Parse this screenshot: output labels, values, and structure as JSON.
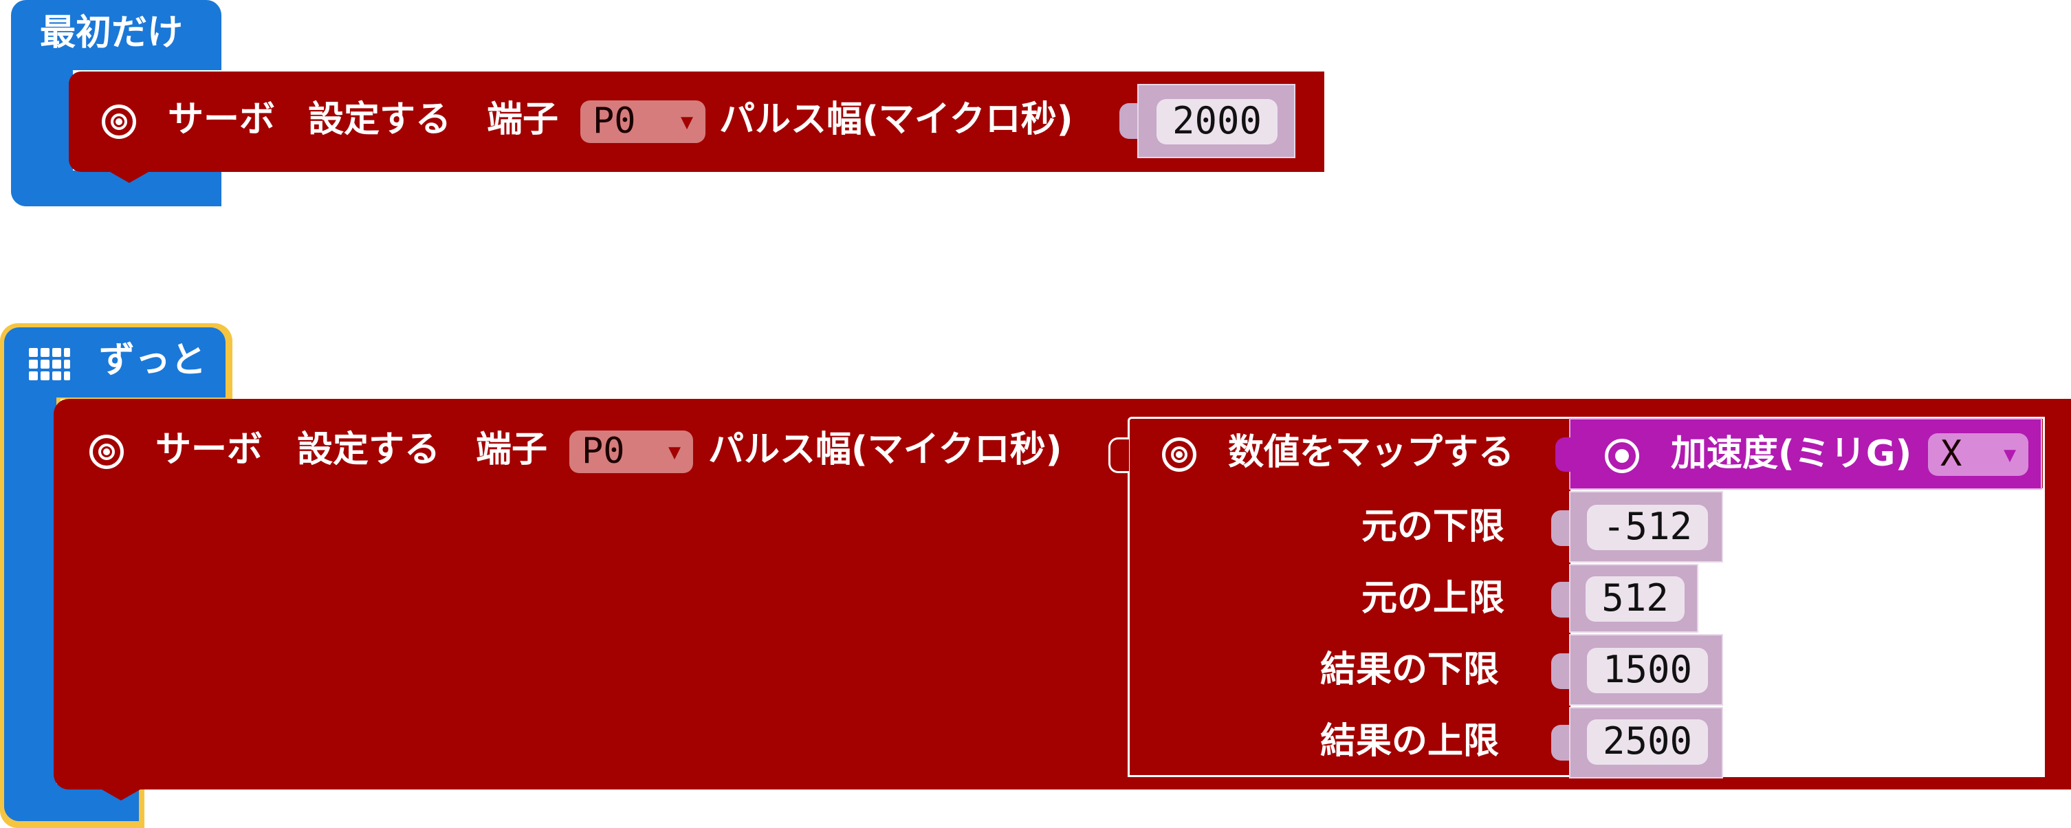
{
  "on_start": {
    "hat_label": "最初だけ",
    "block": {
      "label_servo": "サーボ",
      "label_set": "設定する",
      "label_pin": "端子",
      "pin_value": "P0",
      "label_pulse": "パルス幅(マイクロ秒)",
      "pulse_value": "2000"
    }
  },
  "forever": {
    "hat_label": "ずっと",
    "block": {
      "label_servo": "サーボ",
      "label_set": "設定する",
      "label_pin": "端子",
      "pin_value": "P0",
      "label_pulse": "パルス幅(マイクロ秒)"
    },
    "map_block": {
      "label": "数値をマップする",
      "accel_label": "加速度(ミリG)",
      "axis_value": "X",
      "from_low_label": "元の下限",
      "from_low_value": "-512",
      "from_high_label": "元の上限",
      "from_high_value": "512",
      "to_low_label": "結果の下限",
      "to_low_value": "1500",
      "to_high_label": "結果の上限",
      "to_high_value": "2500"
    }
  },
  "colors": {
    "events_blue": "#1a78d8",
    "servo_red": "#a30000",
    "input_magenta": "#b21ab2",
    "number_slot": "#ece2ec",
    "selected_outline": "#f5c542"
  },
  "icons": {
    "servo": "target-icon",
    "forever": "grid-icon",
    "accel": "target-icon"
  }
}
